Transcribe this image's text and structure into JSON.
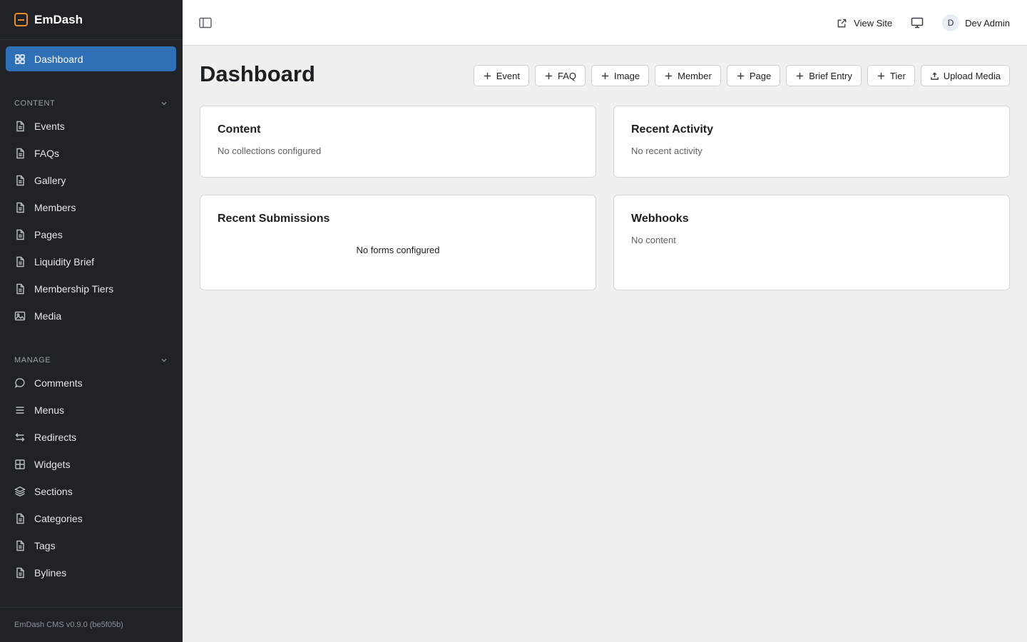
{
  "app": {
    "name": "EmDash",
    "version": "EmDash CMS v0.9.0 (be5f05b)"
  },
  "sidebar": {
    "dashboard_label": "Dashboard",
    "content_section": {
      "title": "CONTENT",
      "items": [
        "Events",
        "FAQs",
        "Gallery",
        "Members",
        "Pages",
        "Liquidity Brief",
        "Membership Tiers",
        "Media"
      ]
    },
    "manage_section": {
      "title": "MANAGE",
      "items": [
        "Comments",
        "Menus",
        "Redirects",
        "Widgets",
        "Sections",
        "Categories",
        "Tags",
        "Bylines"
      ]
    }
  },
  "header": {
    "view_site": "View Site",
    "user_initial": "D",
    "user_name": "Dev Admin"
  },
  "main": {
    "title": "Dashboard",
    "quick_actions": [
      "Event",
      "FAQ",
      "Image",
      "Member",
      "Page",
      "Brief Entry",
      "Tier",
      "Upload Media"
    ],
    "cards": {
      "content": {
        "title": "Content",
        "text": "No collections configured"
      },
      "activity": {
        "title": "Recent Activity",
        "text": "No recent activity"
      },
      "submissions": {
        "title": "Recent Submissions",
        "text": "No forms configured"
      },
      "webhooks": {
        "title": "Webhooks",
        "text": "No content"
      }
    }
  },
  "colors": {
    "accent": "#2e6fb6",
    "brand": "#f08a24",
    "sidebar_bg": "#1f2327"
  }
}
